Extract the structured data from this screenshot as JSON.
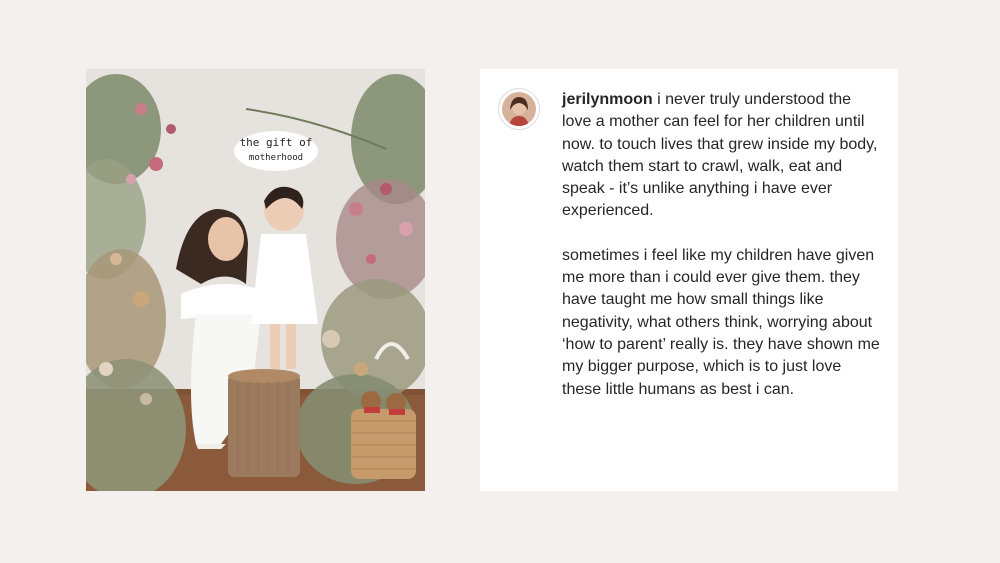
{
  "photo": {
    "overlay_text_line1": "the gift of",
    "overlay_text_line2": "motherhood",
    "description": "mother-holding-toddler-photo"
  },
  "post": {
    "username": "jerilynmoon",
    "caption_paragraph_1": "i never truly understood the love a mother can feel for her children until now. to touch lives that grew inside my body, watch them start to crawl, walk, eat and speak - it’s unlike anything i have ever experienced.",
    "caption_paragraph_2": "sometimes i feel like my children have given me more than i could ever give them. they have taught me how small things like negativity, what others think, worrying about ‘how to parent’ really is. they have shown me my bigger purpose, which is to just love these little humans as best i can."
  },
  "colors": {
    "page_background": "#f3f0ed",
    "card_background": "#ffffff",
    "text": "#262626"
  }
}
